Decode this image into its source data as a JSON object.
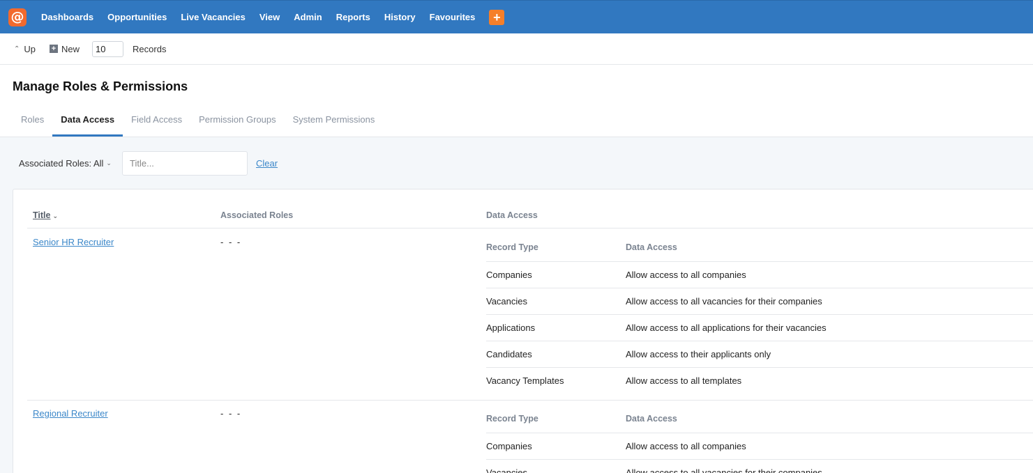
{
  "nav": {
    "items": [
      "Dashboards",
      "Opportunities",
      "Live Vacancies",
      "View",
      "Admin",
      "Reports",
      "History",
      "Favourites"
    ],
    "plus": "+",
    "logo_glyph": "@"
  },
  "toolbar": {
    "up_label": "Up",
    "new_label": "New",
    "records_value": "10",
    "records_label": "Records"
  },
  "page": {
    "title": "Manage Roles & Permissions"
  },
  "tabs": [
    {
      "label": "Roles",
      "active": false
    },
    {
      "label": "Data Access",
      "active": true
    },
    {
      "label": "Field Access",
      "active": false
    },
    {
      "label": "Permission Groups",
      "active": false
    },
    {
      "label": "System Permissions",
      "active": false
    }
  ],
  "filters": {
    "roles_label": "Associated Roles: All",
    "title_placeholder": "Title...",
    "clear_label": "Clear"
  },
  "table": {
    "headers": {
      "title": "Title",
      "roles": "Associated Roles",
      "access": "Data Access"
    },
    "sub_headers": {
      "record_type": "Record Type",
      "data_access": "Data Access"
    },
    "rows": [
      {
        "title": "Senior HR Recruiter",
        "roles": "- - -",
        "access": [
          {
            "type": "Companies",
            "value": "Allow access to all companies"
          },
          {
            "type": "Vacancies",
            "value": "Allow access to all vacancies for their companies"
          },
          {
            "type": "Applications",
            "value": "Allow access to all applications for their vacancies"
          },
          {
            "type": "Candidates",
            "value": "Allow access to their applicants only"
          },
          {
            "type": "Vacancy Templates",
            "value": "Allow access to all templates"
          }
        ]
      },
      {
        "title": "Regional Recruiter",
        "roles": "- - -",
        "access": [
          {
            "type": "Companies",
            "value": "Allow access to all companies"
          },
          {
            "type": "Vacancies",
            "value": "Allow access to all vacancies for their companies"
          }
        ]
      }
    ]
  },
  "colors": {
    "nav_bg": "#3178c0",
    "accent_orange": "#f57f2a",
    "link": "#3b87c9"
  }
}
